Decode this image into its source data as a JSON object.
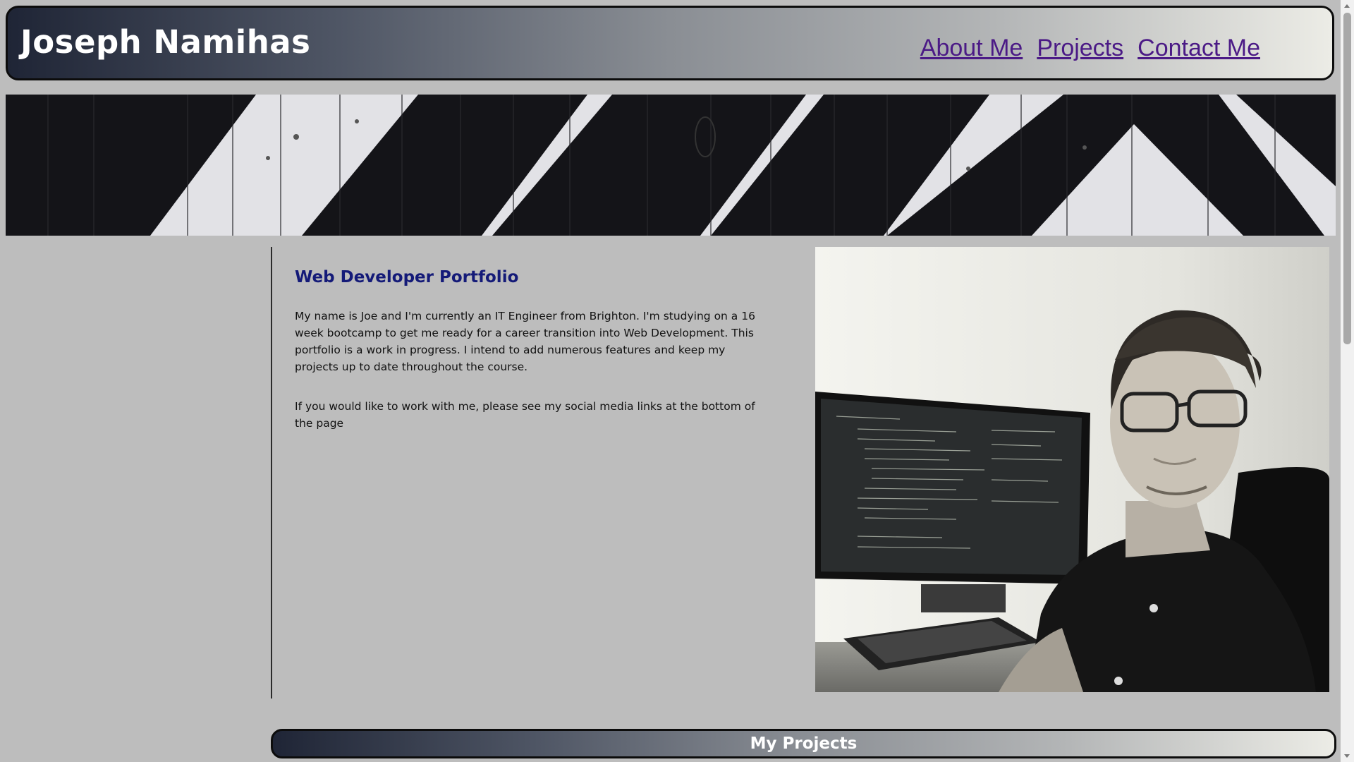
{
  "header": {
    "title": "Joseph Namihas",
    "nav": [
      "About Me",
      "Projects",
      "Contact Me"
    ],
    "link_color": "#4b1a86"
  },
  "banner": {
    "description_icon": "striped-wood-banner-image"
  },
  "about": {
    "heading": "Web Developer Portfolio",
    "paragraphs": [
      "My name is Joe and I'm currently an IT Engineer from Brighton. I'm studying on a 16 week bootcamp to get me ready for a career transition into Web Development. This portfolio is a work in progress. I intend to add numerous features and keep my projects up to date throughout the course.",
      "If you would like to work with me, please see my social media links at the bottom of the page"
    ],
    "heading_color": "#141a78"
  },
  "photo": {
    "icon": "profile-photo-image"
  },
  "projects": {
    "heading": "My Projects"
  },
  "colors": {
    "background": "#bdbdbd",
    "gradient_dark": "#1f2536",
    "gradient_light": "#ecece6"
  }
}
